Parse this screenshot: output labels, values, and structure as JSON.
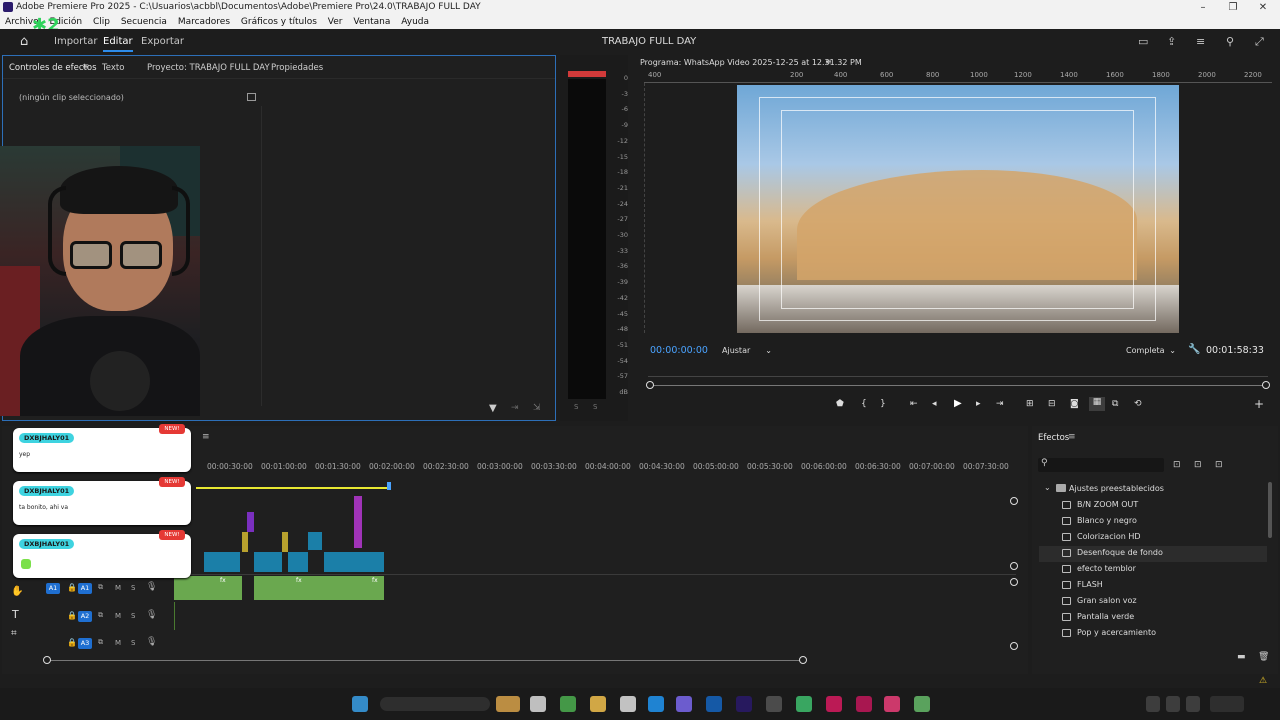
{
  "window": {
    "title": "Adobe Premiere Pro 2025 - C:\\Usuarios\\acbbl\\Documentos\\Adobe\\Premiere Pro\\24.0\\TRABAJO FULL DAY"
  },
  "menu": [
    "Archivo",
    "Edición",
    "Clip",
    "Secuencia",
    "Marcadores",
    "Gráficos y títulos",
    "Ver",
    "Ventana",
    "Ayuda"
  ],
  "header": {
    "import": "Importar",
    "edit": "Editar",
    "export": "Exportar",
    "project_title": "TRABAJO FULL DAY"
  },
  "source_panel": {
    "tabs": [
      "Controles de efectos",
      "Texto",
      "Proyecto: TRABAJO FULL DAY",
      "Propiedades"
    ],
    "no_clip": "(ningún clip seleccionado)"
  },
  "audio_meter": {
    "scale": [
      "0",
      "-3",
      "-6",
      "-9",
      "-12",
      "-15",
      "-18",
      "-21",
      "-24",
      "-27",
      "-30",
      "-33",
      "-36",
      "-39",
      "-42",
      "-45",
      "-48",
      "-51",
      "-54",
      "-57",
      "dB"
    ]
  },
  "program": {
    "title": "Programa: WhatsApp Video 2025-12-25 at 12.31.32 PM",
    "ruler": [
      "400",
      "0",
      "200",
      "400",
      "600",
      "800",
      "1000",
      "1200",
      "1400",
      "1600",
      "1800",
      "2000",
      "2200"
    ],
    "timecode": "00:00:00:00",
    "fit": "Ajustar",
    "quality": "Completa",
    "duration": "00:01:58:33"
  },
  "timeline": {
    "ruler": [
      "00:00:30:00",
      "00:01:00:00",
      "00:01:30:00",
      "00:02:00:00",
      "00:02:30:00",
      "00:03:00:00",
      "00:03:30:00",
      "00:04:00:00",
      "00:04:30:00",
      "00:05:00:00",
      "00:05:30:00",
      "00:06:00:00",
      "00:06:30:00",
      "00:07:00:00",
      "00:07:30:00"
    ],
    "audio_tracks": [
      {
        "src": "A1",
        "tgt": "A1"
      },
      {
        "src": "",
        "tgt": "A2"
      },
      {
        "src": "",
        "tgt": "A3"
      }
    ],
    "m": "M",
    "s": "S",
    "fx": "fx"
  },
  "effects": {
    "title": "Efectos",
    "folder": "Ajustes preestablecidos",
    "items": [
      "B/N ZOOM OUT",
      "Blanco y negro",
      "Colorizacion HD",
      "Desenfoque de fondo",
      "efecto temblor",
      "FLASH",
      "Gran salon voz",
      "Pantalla verde",
      "Pop y acercamiento"
    ]
  },
  "chat": [
    {
      "user": "DXBJHALY01",
      "badge": "NEW!",
      "msg": "yep"
    },
    {
      "user": "DXBJHALY01",
      "badge": "NEW!",
      "msg": "ta bonito, ahi va"
    },
    {
      "user": "DXBJHALY01",
      "badge": "NEW!",
      "msg": ""
    }
  ],
  "colors": {
    "accent": "#2d8ceb",
    "timecode": "#4aa3ff",
    "track_blue": "#1f6fd1"
  }
}
